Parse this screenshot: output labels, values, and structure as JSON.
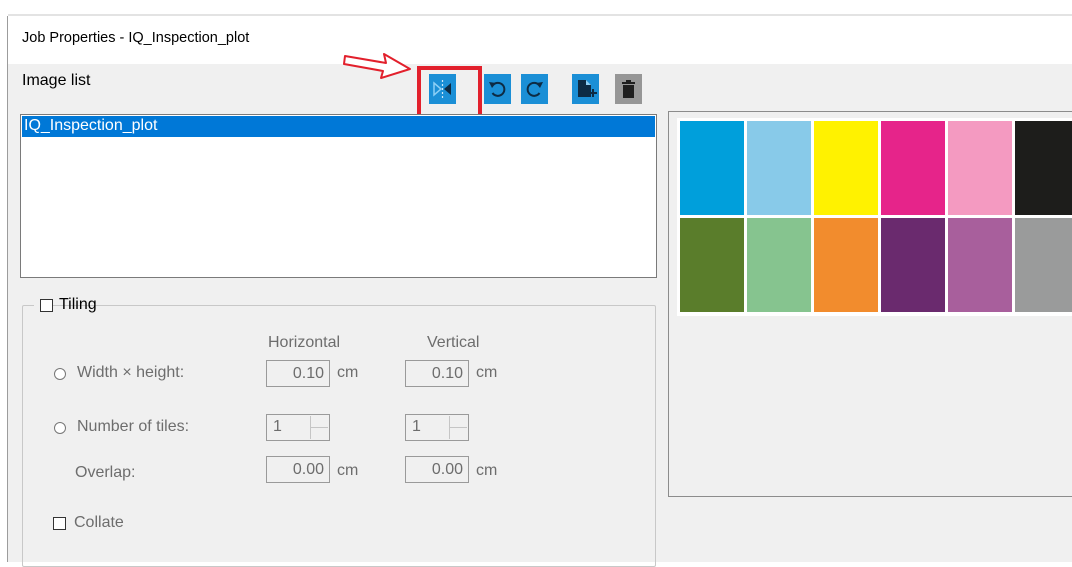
{
  "window": {
    "title": "Job Properties - IQ_Inspection_plot"
  },
  "image_list": {
    "label": "Image list",
    "items": [
      "IQ_Inspection_plot"
    ],
    "selected_index": 0
  },
  "toolbar": {
    "buttons": [
      {
        "name": "mirror",
        "icon": "mirror-icon",
        "highlighted": true
      },
      {
        "name": "rotate-left",
        "icon": "rotate-left-icon"
      },
      {
        "name": "rotate-right",
        "icon": "rotate-right-icon"
      },
      {
        "name": "add-image",
        "icon": "add-file-icon"
      },
      {
        "name": "delete",
        "icon": "trash-icon"
      }
    ]
  },
  "tiling": {
    "label": "Tiling",
    "checked": false,
    "col_horizontal": "Horizontal",
    "col_vertical": "Vertical",
    "width_height": {
      "label": "Width × height:",
      "h_value": "0.10",
      "v_value": "0.10",
      "unit": "cm"
    },
    "number_of_tiles": {
      "label": "Number of tiles:",
      "h_value": "1",
      "v_value": "1"
    },
    "overlap": {
      "label": "Overlap:",
      "h_value": "0.00",
      "v_value": "0.00",
      "unit": "cm"
    },
    "collate": {
      "label": "Collate",
      "checked": false
    }
  },
  "preview": {
    "swatch_rows": [
      [
        "#009fdb",
        "#88cae9",
        "#fff200",
        "#e6248a",
        "#f49ac1",
        "#1d1d1b"
      ],
      [
        "#5a7d2b",
        "#86c48f",
        "#f28c2d",
        "#6a2a6e",
        "#a85f9c",
        "#9a9b9b"
      ]
    ]
  },
  "colors": {
    "accent": "#0078d7",
    "toolbar_button": "#1b8fd6",
    "highlight": "#e2202c",
    "dialog_bg": "#f0f0f0"
  }
}
